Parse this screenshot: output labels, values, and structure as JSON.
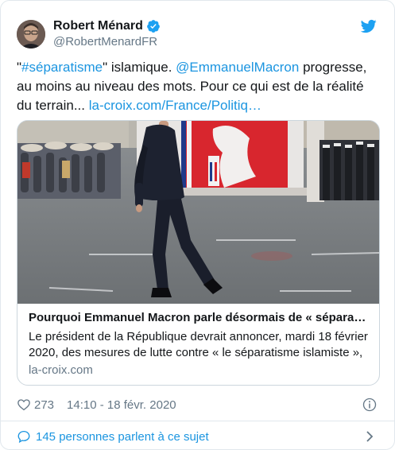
{
  "author": {
    "display_name": "Robert Ménard",
    "handle": "@RobertMenardFR",
    "verified_icon": "verified-badge-icon",
    "platform_icon": "twitter-bird-icon"
  },
  "tweet": {
    "quote_open": "\"",
    "hashtag": "#séparatisme",
    "quote_close": "\"",
    "text_1": " islamique. ",
    "mention": "@EmmanuelMacron",
    "text_2": " progresse, au moins au niveau des mots. Pour ce qui est de la réalité du terrain... ",
    "link": "la-croix.com/France/Politiq…"
  },
  "card": {
    "title": "Pourquoi Emmanuel Macron parle désormais de « séparatisme islamiste »",
    "description": "Le président de la République devrait annoncer, mardi 18 février 2020, des mesures de lutte contre « le séparatisme islamiste », une",
    "domain": "la-croix.com"
  },
  "meta": {
    "likes": "273",
    "timestamp": "14:10 - 18 févr. 2020"
  },
  "footer": {
    "conversation": "145 personnes parlent à ce sujet"
  },
  "colors": {
    "link": "#1b95e0",
    "secondary": "#657786",
    "border": "#ccd6dd"
  }
}
